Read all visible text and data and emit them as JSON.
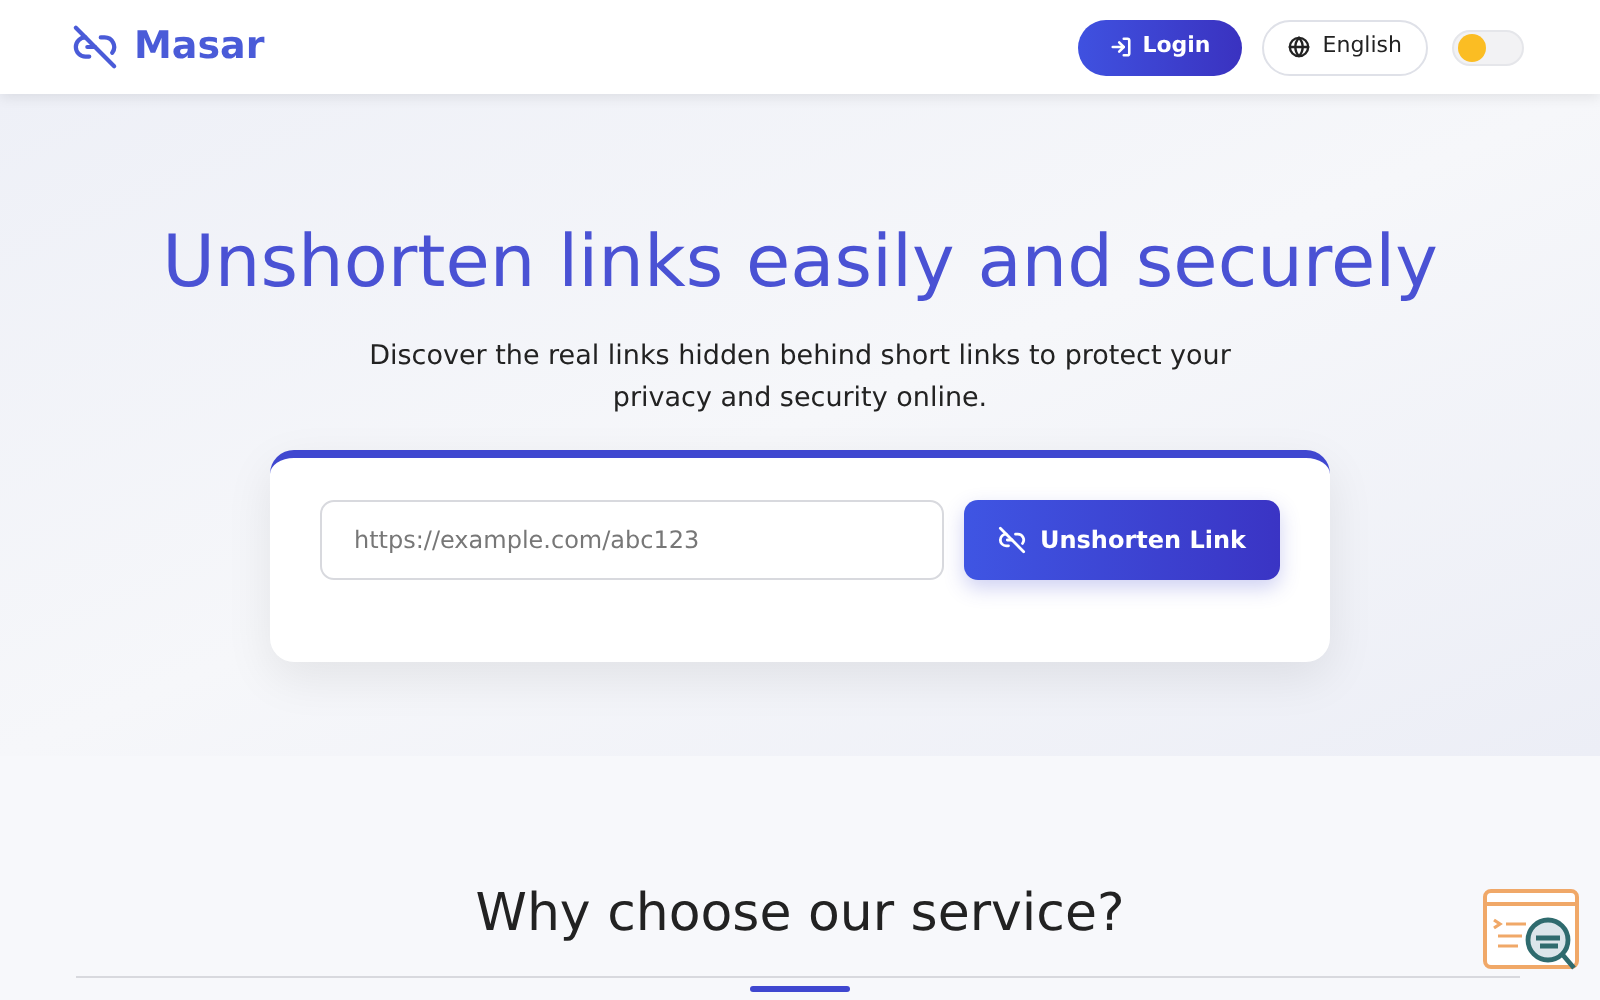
{
  "header": {
    "brand": "Masar",
    "login": "Login",
    "language": "English",
    "dark_mode": false
  },
  "hero": {
    "title": "Unshorten links easily and securely",
    "subtitle": "Discover the real links hidden behind short links to protect your privacy and security online."
  },
  "form": {
    "placeholder": "https://example.com/abc123",
    "button": "Unshorten Link"
  },
  "features": {
    "heading": "Why choose our service?"
  }
}
